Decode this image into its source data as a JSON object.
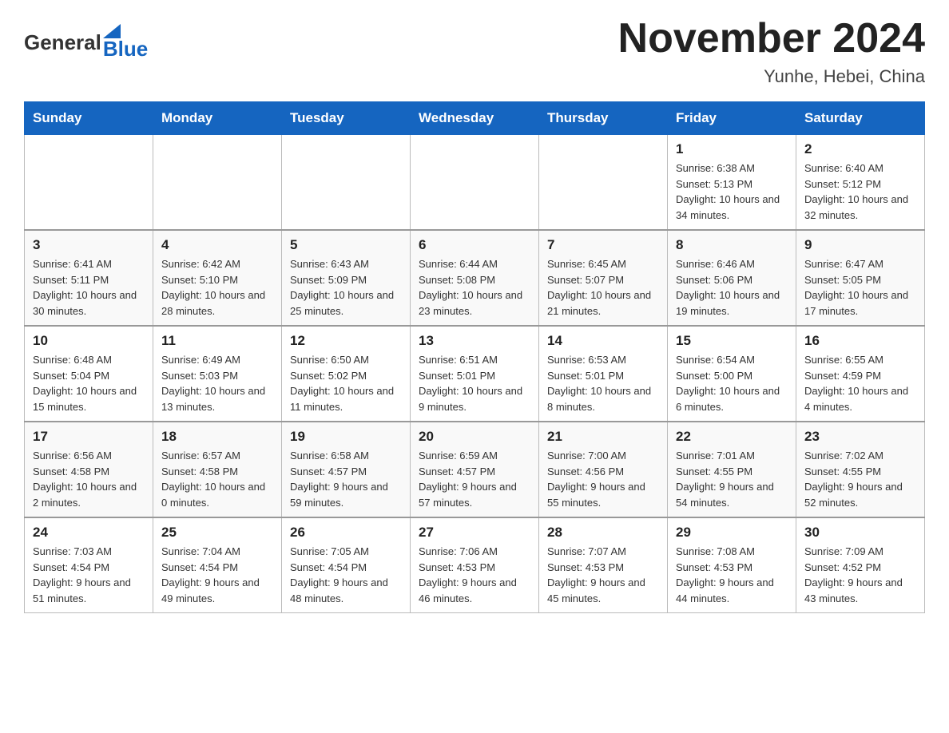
{
  "header": {
    "logo": {
      "general": "General",
      "blue": "Blue"
    },
    "title": "November 2024",
    "subtitle": "Yunhe, Hebei, China"
  },
  "weekdays": [
    "Sunday",
    "Monday",
    "Tuesday",
    "Wednesday",
    "Thursday",
    "Friday",
    "Saturday"
  ],
  "weeks": [
    {
      "days": [
        {
          "number": "",
          "sunrise": "",
          "sunset": "",
          "daylight": ""
        },
        {
          "number": "",
          "sunrise": "",
          "sunset": "",
          "daylight": ""
        },
        {
          "number": "",
          "sunrise": "",
          "sunset": "",
          "daylight": ""
        },
        {
          "number": "",
          "sunrise": "",
          "sunset": "",
          "daylight": ""
        },
        {
          "number": "",
          "sunrise": "",
          "sunset": "",
          "daylight": ""
        },
        {
          "number": "1",
          "sunrise": "Sunrise: 6:38 AM",
          "sunset": "Sunset: 5:13 PM",
          "daylight": "Daylight: 10 hours and 34 minutes."
        },
        {
          "number": "2",
          "sunrise": "Sunrise: 6:40 AM",
          "sunset": "Sunset: 5:12 PM",
          "daylight": "Daylight: 10 hours and 32 minutes."
        }
      ]
    },
    {
      "days": [
        {
          "number": "3",
          "sunrise": "Sunrise: 6:41 AM",
          "sunset": "Sunset: 5:11 PM",
          "daylight": "Daylight: 10 hours and 30 minutes."
        },
        {
          "number": "4",
          "sunrise": "Sunrise: 6:42 AM",
          "sunset": "Sunset: 5:10 PM",
          "daylight": "Daylight: 10 hours and 28 minutes."
        },
        {
          "number": "5",
          "sunrise": "Sunrise: 6:43 AM",
          "sunset": "Sunset: 5:09 PM",
          "daylight": "Daylight: 10 hours and 25 minutes."
        },
        {
          "number": "6",
          "sunrise": "Sunrise: 6:44 AM",
          "sunset": "Sunset: 5:08 PM",
          "daylight": "Daylight: 10 hours and 23 minutes."
        },
        {
          "number": "7",
          "sunrise": "Sunrise: 6:45 AM",
          "sunset": "Sunset: 5:07 PM",
          "daylight": "Daylight: 10 hours and 21 minutes."
        },
        {
          "number": "8",
          "sunrise": "Sunrise: 6:46 AM",
          "sunset": "Sunset: 5:06 PM",
          "daylight": "Daylight: 10 hours and 19 minutes."
        },
        {
          "number": "9",
          "sunrise": "Sunrise: 6:47 AM",
          "sunset": "Sunset: 5:05 PM",
          "daylight": "Daylight: 10 hours and 17 minutes."
        }
      ]
    },
    {
      "days": [
        {
          "number": "10",
          "sunrise": "Sunrise: 6:48 AM",
          "sunset": "Sunset: 5:04 PM",
          "daylight": "Daylight: 10 hours and 15 minutes."
        },
        {
          "number": "11",
          "sunrise": "Sunrise: 6:49 AM",
          "sunset": "Sunset: 5:03 PM",
          "daylight": "Daylight: 10 hours and 13 minutes."
        },
        {
          "number": "12",
          "sunrise": "Sunrise: 6:50 AM",
          "sunset": "Sunset: 5:02 PM",
          "daylight": "Daylight: 10 hours and 11 minutes."
        },
        {
          "number": "13",
          "sunrise": "Sunrise: 6:51 AM",
          "sunset": "Sunset: 5:01 PM",
          "daylight": "Daylight: 10 hours and 9 minutes."
        },
        {
          "number": "14",
          "sunrise": "Sunrise: 6:53 AM",
          "sunset": "Sunset: 5:01 PM",
          "daylight": "Daylight: 10 hours and 8 minutes."
        },
        {
          "number": "15",
          "sunrise": "Sunrise: 6:54 AM",
          "sunset": "Sunset: 5:00 PM",
          "daylight": "Daylight: 10 hours and 6 minutes."
        },
        {
          "number": "16",
          "sunrise": "Sunrise: 6:55 AM",
          "sunset": "Sunset: 4:59 PM",
          "daylight": "Daylight: 10 hours and 4 minutes."
        }
      ]
    },
    {
      "days": [
        {
          "number": "17",
          "sunrise": "Sunrise: 6:56 AM",
          "sunset": "Sunset: 4:58 PM",
          "daylight": "Daylight: 10 hours and 2 minutes."
        },
        {
          "number": "18",
          "sunrise": "Sunrise: 6:57 AM",
          "sunset": "Sunset: 4:58 PM",
          "daylight": "Daylight: 10 hours and 0 minutes."
        },
        {
          "number": "19",
          "sunrise": "Sunrise: 6:58 AM",
          "sunset": "Sunset: 4:57 PM",
          "daylight": "Daylight: 9 hours and 59 minutes."
        },
        {
          "number": "20",
          "sunrise": "Sunrise: 6:59 AM",
          "sunset": "Sunset: 4:57 PM",
          "daylight": "Daylight: 9 hours and 57 minutes."
        },
        {
          "number": "21",
          "sunrise": "Sunrise: 7:00 AM",
          "sunset": "Sunset: 4:56 PM",
          "daylight": "Daylight: 9 hours and 55 minutes."
        },
        {
          "number": "22",
          "sunrise": "Sunrise: 7:01 AM",
          "sunset": "Sunset: 4:55 PM",
          "daylight": "Daylight: 9 hours and 54 minutes."
        },
        {
          "number": "23",
          "sunrise": "Sunrise: 7:02 AM",
          "sunset": "Sunset: 4:55 PM",
          "daylight": "Daylight: 9 hours and 52 minutes."
        }
      ]
    },
    {
      "days": [
        {
          "number": "24",
          "sunrise": "Sunrise: 7:03 AM",
          "sunset": "Sunset: 4:54 PM",
          "daylight": "Daylight: 9 hours and 51 minutes."
        },
        {
          "number": "25",
          "sunrise": "Sunrise: 7:04 AM",
          "sunset": "Sunset: 4:54 PM",
          "daylight": "Daylight: 9 hours and 49 minutes."
        },
        {
          "number": "26",
          "sunrise": "Sunrise: 7:05 AM",
          "sunset": "Sunset: 4:54 PM",
          "daylight": "Daylight: 9 hours and 48 minutes."
        },
        {
          "number": "27",
          "sunrise": "Sunrise: 7:06 AM",
          "sunset": "Sunset: 4:53 PM",
          "daylight": "Daylight: 9 hours and 46 minutes."
        },
        {
          "number": "28",
          "sunrise": "Sunrise: 7:07 AM",
          "sunset": "Sunset: 4:53 PM",
          "daylight": "Daylight: 9 hours and 45 minutes."
        },
        {
          "number": "29",
          "sunrise": "Sunrise: 7:08 AM",
          "sunset": "Sunset: 4:53 PM",
          "daylight": "Daylight: 9 hours and 44 minutes."
        },
        {
          "number": "30",
          "sunrise": "Sunrise: 7:09 AM",
          "sunset": "Sunset: 4:52 PM",
          "daylight": "Daylight: 9 hours and 43 minutes."
        }
      ]
    }
  ]
}
